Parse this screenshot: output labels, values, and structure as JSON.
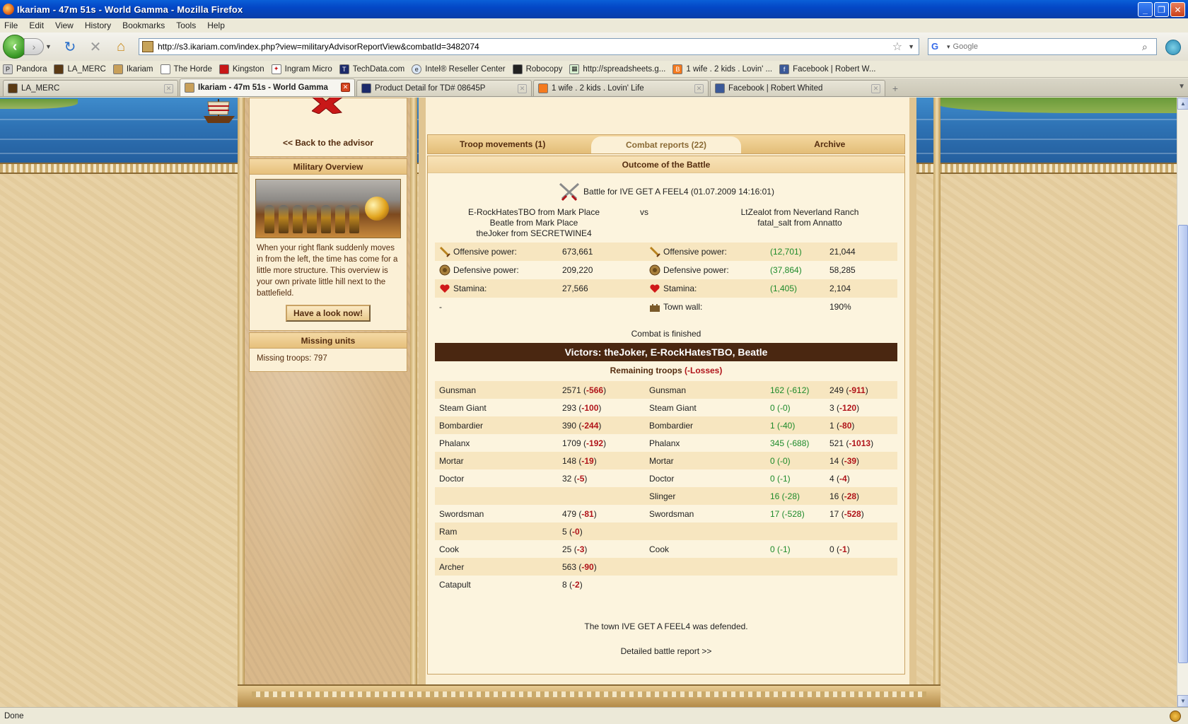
{
  "window": {
    "title": "Ikariam - 47m 51s - World Gamma - Mozilla Firefox"
  },
  "menu": [
    "File",
    "Edit",
    "View",
    "History",
    "Bookmarks",
    "Tools",
    "Help"
  ],
  "address": {
    "url": "http://s3.ikariam.com/index.php?view=militaryAdvisorReportView&combatId=3482074"
  },
  "search": {
    "placeholder": "Google"
  },
  "bookmarks": [
    "Pandora",
    "LA_MERC",
    "Ikariam",
    "The Horde",
    "Kingston",
    "Ingram Micro",
    "TechData.com",
    "Intel® Reseller Center",
    "Robocopy",
    "http://spreadsheets.g...",
    "1 wife . 2 kids . Lovin' ...",
    "Facebook | Robert W..."
  ],
  "tabs": [
    {
      "label": "LA_MERC"
    },
    {
      "label": "Ikariam - 47m 51s - World Gamma"
    },
    {
      "label": "Product Detail for TD# 08645P"
    },
    {
      "label": "1 wife . 2 kids . Lovin' Life"
    },
    {
      "label": "Facebook | Robert Whited"
    }
  ],
  "sidebar": {
    "back_link": "<< Back to the advisor",
    "military_overview": {
      "title": "Military Overview",
      "text": "When your right flank suddenly moves in from the left, the time has come for a little more structure. This overview is your own private little hill next to the battlefield.",
      "button": "Have a look now!"
    },
    "missing_units": {
      "title": "Missing units",
      "text": "Missing troops: 797"
    }
  },
  "report": {
    "tabs": [
      "Troop movements (1)",
      "Combat reports (22)",
      "Archive"
    ],
    "header": "Outcome of the Battle",
    "battle_title": "Battle for IVE GET A FEEL4 (01.07.2009 14:16:01)",
    "attackers": [
      "E-RockHatesTBO from Mark Place",
      "Beatle from Mark Place",
      "theJoker from SECRETWINE4"
    ],
    "vs": "vs",
    "defenders": [
      "LtZealot from Neverland Ranch",
      "fatal_salt from Annatto"
    ],
    "stats": [
      {
        "label": "Offensive power:",
        "att": "673,661",
        "dlabel": "Offensive power:",
        "dgreen": "(12,701)",
        "dval": "21,044"
      },
      {
        "label": "Defensive power:",
        "att": "209,220",
        "dlabel": "Defensive power:",
        "dgreen": "(37,864)",
        "dval": "58,285"
      },
      {
        "label": "Stamina:",
        "att": "27,566",
        "dlabel": "Stamina:",
        "dgreen": "(1,405)",
        "dval": "2,104"
      },
      {
        "label": "-",
        "att": "",
        "dlabel": "Town wall:",
        "dgreen": "",
        "dval": "190%"
      }
    ],
    "status": "Combat is finished",
    "victors": "Victors: theJoker, E-RockHatesTBO, Beatle",
    "remaining_label": "Remaining troops",
    "losses_label": "(-Losses)",
    "troops": [
      {
        "unit": "Gunsman",
        "att": "2571",
        "att_loss": "-566",
        "dunit": "Gunsman",
        "dgreen": "162 (-612)",
        "dval": "249",
        "dloss": "-911"
      },
      {
        "unit": "Steam Giant",
        "att": "293",
        "att_loss": "-100",
        "dunit": "Steam Giant",
        "dgreen": "0 (-0)",
        "dval": "3",
        "dloss": "-120"
      },
      {
        "unit": "Bombardier",
        "att": "390",
        "att_loss": "-244",
        "dunit": "Bombardier",
        "dgreen": "1 (-40)",
        "dval": "1",
        "dloss": "-80"
      },
      {
        "unit": "Phalanx",
        "att": "1709",
        "att_loss": "-192",
        "dunit": "Phalanx",
        "dgreen": "345 (-688)",
        "dval": "521",
        "dloss": "-1013"
      },
      {
        "unit": "Mortar",
        "att": "148",
        "att_loss": "-19",
        "dunit": "Mortar",
        "dgreen": "0 (-0)",
        "dval": "14",
        "dloss": "-39"
      },
      {
        "unit": "Doctor",
        "att": "32",
        "att_loss": "-5",
        "dunit": "Doctor",
        "dgreen": "0 (-1)",
        "dval": "4",
        "dloss": "-4"
      },
      {
        "unit": "",
        "att": "",
        "att_loss": "",
        "dunit": "Slinger",
        "dgreen": "16 (-28)",
        "dval": "16",
        "dloss": "-28"
      },
      {
        "unit": "Swordsman",
        "att": "479",
        "att_loss": "-81",
        "dunit": "Swordsman",
        "dgreen": "17 (-528)",
        "dval": "17",
        "dloss": "-528"
      },
      {
        "unit": "Ram",
        "att": "5",
        "att_loss": "-0",
        "dunit": "",
        "dgreen": "",
        "dval": "",
        "dloss": ""
      },
      {
        "unit": "Cook",
        "att": "25",
        "att_loss": "-3",
        "dunit": "Cook",
        "dgreen": "0 (-1)",
        "dval": "0",
        "dloss": "-1"
      },
      {
        "unit": "Archer",
        "att": "563",
        "att_loss": "-90",
        "dunit": "",
        "dgreen": "",
        "dval": "",
        "dloss": ""
      },
      {
        "unit": "Catapult",
        "att": "8",
        "att_loss": "-2",
        "dunit": "",
        "dgreen": "",
        "dval": "",
        "dloss": ""
      }
    ],
    "defended": "The town IVE GET A FEEL4 was defended.",
    "detailed_link": "Detailed battle report >>"
  },
  "statusbar": {
    "text": "Done"
  },
  "colors": {
    "victors_bg": "#4a2711",
    "loss": "#b0141a",
    "green": "#1d8a2a",
    "panel": "#fbf0d6"
  }
}
